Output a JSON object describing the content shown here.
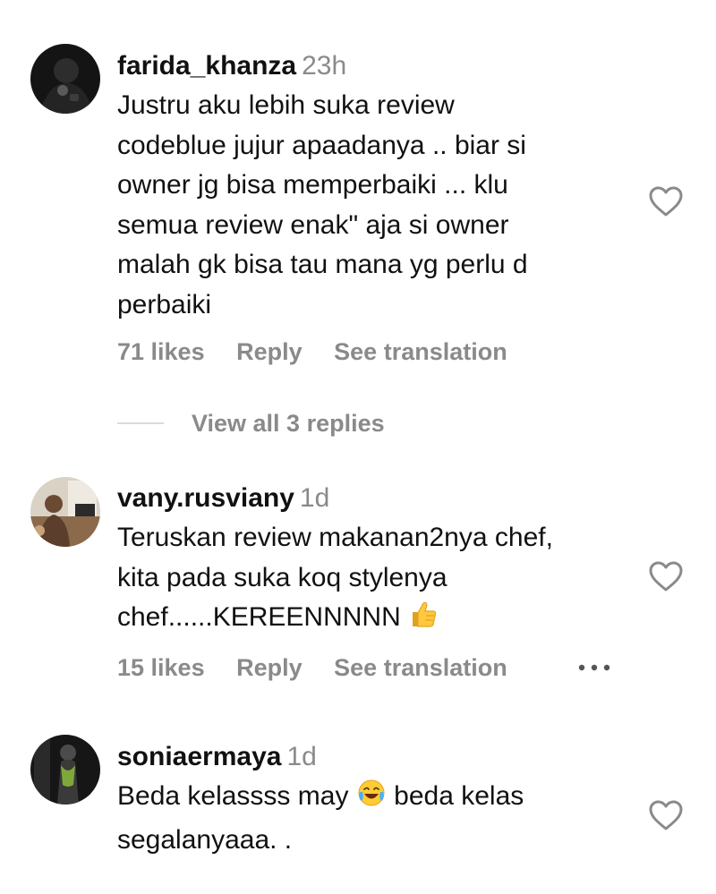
{
  "comments": [
    {
      "username": "farida_khanza",
      "time": "23h",
      "text_lines": [
        "Justru aku lebih suka review",
        "codeblue jujur apaadanya .. biar si",
        "owner jg bisa memperbaiki ... klu",
        "semua review enak\" aja si owner",
        "malah gk bisa tau mana yg perlu d",
        "perbaiki"
      ],
      "likes": "71 likes",
      "reply": "Reply",
      "translate": "See translation",
      "avatar_icon": "user-avatar-dark-icon"
    },
    {
      "username": "vany.rusviany",
      "time": "1d",
      "text_lines": [
        "Teruskan review makanan2nya chef,",
        "kita pada suka koq stylenya",
        "chef......KEREENNNNN"
      ],
      "likes": "15 likes",
      "reply": "Reply",
      "translate": "See translation",
      "avatar_icon": "user-avatar-photo-icon",
      "emoji": "thumbs-up-icon"
    },
    {
      "username": "soniaermaya",
      "time": "1d",
      "text_line1_a": "Beda kelassss may",
      "text_line1_b": "beda kelas",
      "text_line2": "segalanyaaa. .",
      "avatar_icon": "user-avatar-dark-icon",
      "emoji": "tears-of-joy-icon"
    }
  ],
  "view_replies": "View all 3 replies",
  "colors": {
    "text": "#111111",
    "secondary": "#8a8a8a",
    "divider": "#dbdbdb"
  }
}
